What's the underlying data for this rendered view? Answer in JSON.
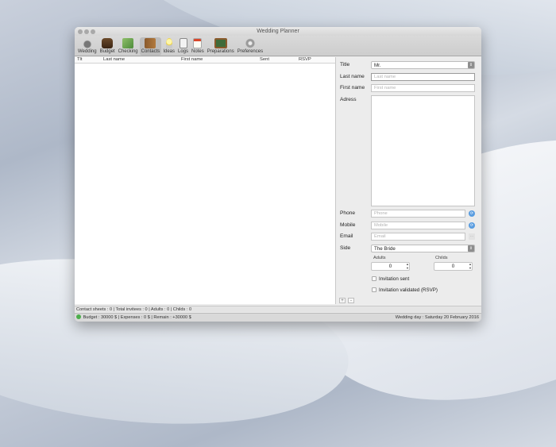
{
  "window": {
    "title": "Wedding Planner"
  },
  "toolbar": {
    "items": [
      {
        "label": "Wedding",
        "icon": "wedding-cake-icon"
      },
      {
        "label": "Budget",
        "icon": "money-bag-icon"
      },
      {
        "label": "Checking",
        "icon": "checklist-icon"
      },
      {
        "label": "Contacts",
        "icon": "address-book-icon",
        "active": true
      },
      {
        "label": "Ideas",
        "icon": "lightbulb-icon"
      },
      {
        "label": "Logs",
        "icon": "logbook-icon"
      },
      {
        "label": "Notes",
        "icon": "notepad-icon"
      },
      {
        "label": "Preparations",
        "icon": "chalkboard-icon"
      },
      {
        "label": "Preferences",
        "icon": "gear-icon"
      }
    ]
  },
  "list": {
    "columns": [
      "Tlt",
      "Last name",
      "First name",
      "Sent",
      "RSVP"
    ]
  },
  "form": {
    "title_label": "Title",
    "title_value": "Mr.",
    "lastname_label": "Last name",
    "lastname_placeholder": "Last name",
    "firstname_label": "First name",
    "firstname_placeholder": "First name",
    "address_label": "Adress",
    "phone_label": "Phone",
    "phone_placeholder": "Phone",
    "mobile_label": "Mobile",
    "mobile_placeholder": "Mobile",
    "email_label": "Email",
    "email_placeholder": "Email",
    "side_label": "Side",
    "side_value": "The Bride",
    "adults_label": "Adults",
    "adults_value": "0",
    "childs_label": "Childs",
    "childs_value": "0",
    "invitation_sent_label": "Invitation sent",
    "invitation_validated_label": "Invitation validated (RSVP)"
  },
  "buttons": {
    "add": "+",
    "remove": "-"
  },
  "status": {
    "summary": "Contact sheets : 0  |  Total invitees : 0  |  Adults : 0  |  Childs : 0",
    "budget": "Budget : 30000 $",
    "expenses": "Expenses : 0 $",
    "remain": "Remain : +30000 $",
    "wedding_day": "Wedding day : Saturday 20 February 2016"
  }
}
